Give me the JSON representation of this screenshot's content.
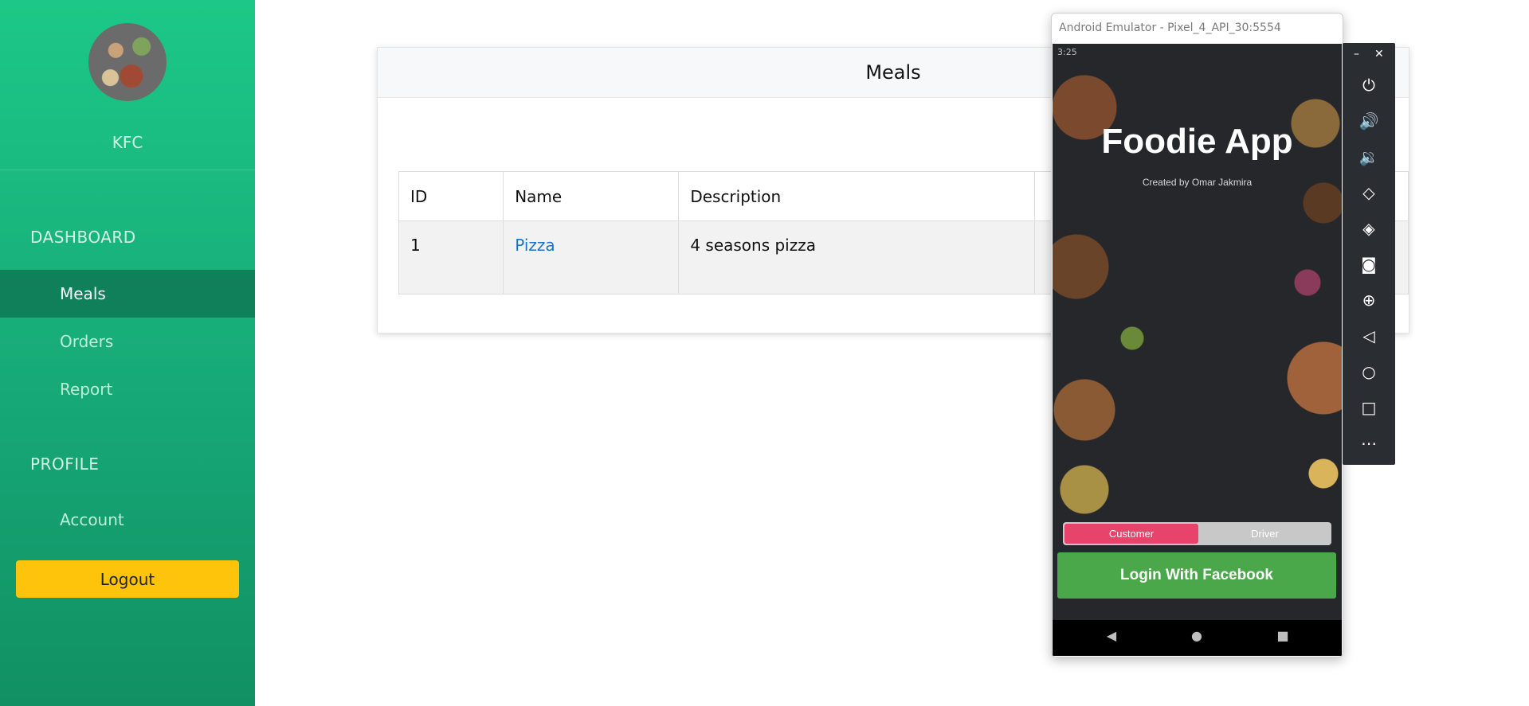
{
  "sidebar": {
    "restaurant_name": "KFC",
    "sections": [
      {
        "title": "DASHBOARD"
      },
      {
        "title": "PROFILE"
      }
    ],
    "items": [
      {
        "label": "Meals",
        "active": true
      },
      {
        "label": "Orders",
        "active": false
      },
      {
        "label": "Report",
        "active": false
      },
      {
        "label": "Account",
        "active": false
      }
    ],
    "logout_label": "Logout",
    "colors": {
      "gradient_top": "#1cc887",
      "gradient_bottom": "#119063",
      "active_bg": "#10805a",
      "logout_bg": "#fec40c"
    }
  },
  "card": {
    "title": "Meals",
    "table": {
      "headers": [
        "ID",
        "Name",
        "Description"
      ],
      "rows": [
        {
          "id": "1",
          "name": "Pizza",
          "description": "4 seasons pizza"
        }
      ]
    }
  },
  "emulator": {
    "window_title": "Android Emulator - Pixel_4_API_30:5554",
    "status_time": "3:25",
    "app_title": "Foodie App",
    "app_subtitle": "Created by Omar Jakmira",
    "toggle": {
      "customer_label": "Customer",
      "driver_label": "Driver",
      "selected": "Customer"
    },
    "facebook_button": "Login With Facebook",
    "toolbar_icons": [
      "power-icon",
      "volume-up-icon",
      "volume-down-icon",
      "rotate-left-icon",
      "rotate-right-icon",
      "camera-icon",
      "zoom-icon",
      "back-icon",
      "home-icon",
      "overview-icon",
      "more-icon"
    ],
    "colors": {
      "customer_active": "#e8446b",
      "facebook_green": "#4aa84b"
    }
  }
}
